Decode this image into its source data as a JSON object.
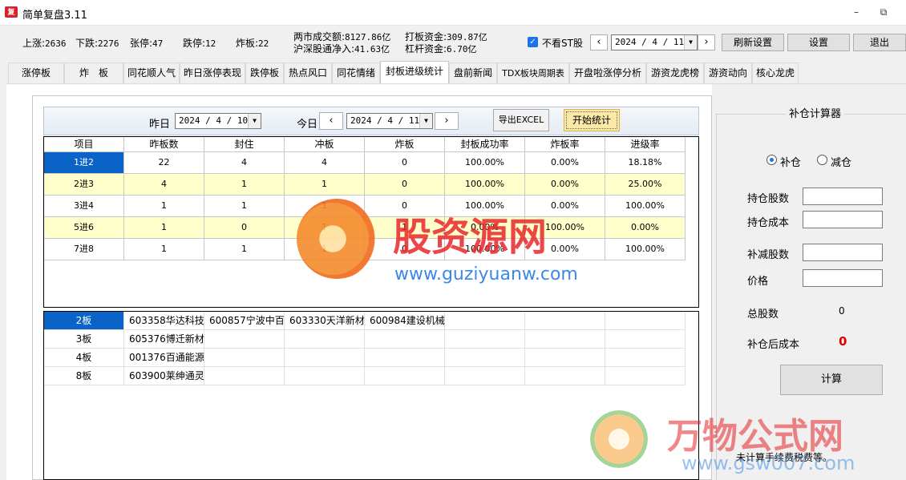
{
  "window": {
    "title": "简单复盘3.11",
    "app_icon": "复",
    "minimize": "–",
    "restore": "⧉"
  },
  "status": {
    "up_label": "上涨:",
    "up": "2636",
    "down_label": "下跌:",
    "down": "2276",
    "limit_up_label": "张停:",
    "limit_up": "47",
    "limit_down_label": "跌停:",
    "limit_down": "12",
    "broken_label": "炸板:",
    "broken": "22",
    "turnover_label": "两市成交额:",
    "turnover": "8127.86亿",
    "northbound_label": "沪深股通净入:",
    "northbound": "41.63亿",
    "board_fund_label": "打板资金:",
    "board_fund": "309.87亿",
    "leverage_fund_label": "杠杆资金:",
    "leverage_fund": "6.70亿",
    "hide_st_label": "不看ST股",
    "hide_st_checked": true,
    "date": "2024 / 4 / 11",
    "prev": "‹",
    "next": "›",
    "refresh_label": "刷新设置",
    "settings_label": "设置",
    "exit_label": "退出"
  },
  "tabs": [
    "涨停板",
    "炸　板",
    "同花顺人气",
    "昨日涨停表现",
    "跌停板",
    "热点风口",
    "同花情绪",
    "封板进级统计",
    "盘前新闻",
    "TDX板块周期表",
    "开盘啦涨停分析",
    "游资龙虎榜",
    "游资动向",
    "核心龙虎"
  ],
  "active_tab": 7,
  "toolbar": {
    "yesterday_label": "昨日",
    "yesterday_date": "2024 / 4 / 10",
    "today_label": "今日",
    "today_date": "2024 / 4 / 11",
    "export_label": "导出EXCEL",
    "start_label": "开始统计"
  },
  "table1": {
    "headers": [
      "项目",
      "昨板数",
      "封住",
      "冲板",
      "炸板",
      "封板成功率",
      "炸板率",
      "进级率"
    ],
    "rows": [
      [
        "1进2",
        "22",
        "4",
        "4",
        "0",
        "100.00%",
        "0.00%",
        "18.18%"
      ],
      [
        "2进3",
        "4",
        "1",
        "1",
        "0",
        "100.00%",
        "0.00%",
        "25.00%"
      ],
      [
        "3进4",
        "1",
        "1",
        "1",
        "0",
        "100.00%",
        "0.00%",
        "100.00%"
      ],
      [
        "5进6",
        "1",
        "0",
        "1",
        "1",
        "0.00%",
        "100.00%",
        "0.00%"
      ],
      [
        "7进8",
        "1",
        "1",
        "1",
        "0",
        "100.00%",
        "0.00%",
        "100.00%"
      ]
    ]
  },
  "table2": {
    "rows": [
      [
        "2板",
        "603358华达科技",
        "600857宁波中百",
        "603330天洋新材",
        "600984建设机械"
      ],
      [
        "3板",
        "605376博迁新材",
        "",
        "",
        ""
      ],
      [
        "4板",
        "001376百通能源",
        "",
        "",
        ""
      ],
      [
        "8板",
        "603900莱绅通灵",
        "",
        "",
        ""
      ]
    ]
  },
  "calculator": {
    "title": "补仓计算器",
    "mode_add": "补仓",
    "mode_reduce": "减仓",
    "selected_mode": "add",
    "hold_shares_label": "持仓股数",
    "hold_cost_label": "持仓成本",
    "change_shares_label": "补减股数",
    "price_label": "价格",
    "total_shares_label": "总股数",
    "total_shares": "0",
    "after_cost_label": "补仓后成本",
    "after_cost": "0",
    "calc_label": "计算",
    "note": "未计算手续费税费等。"
  },
  "watermarks": {
    "wm1_title": "股资源网",
    "wm1_url": "www.guziyuanw.com",
    "wm2_title": "万物公式网",
    "wm2_url": "www.gsw007.com"
  },
  "colors": {
    "accent": "#0a64c8",
    "highlight_row": "#ffffcc",
    "cost_value": "#e00000",
    "start_btn": "#fbe9a8"
  }
}
